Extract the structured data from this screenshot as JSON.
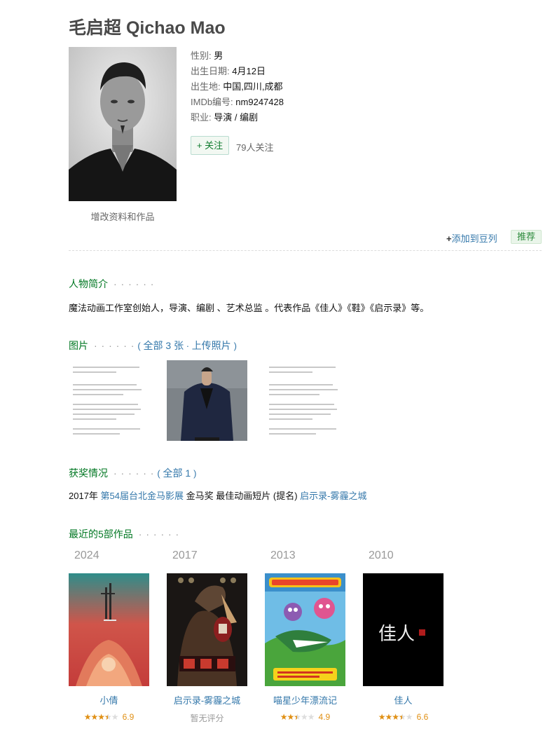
{
  "person": {
    "name": "毛启超 Qichao Mao",
    "gender_label": "性别:",
    "gender": "男",
    "birth_label": "出生日期:",
    "birth": "4月12日",
    "place_label": "出生地:",
    "place": "中国,四川,成都",
    "imdb_label": "IMDb编号:",
    "imdb": "nm9247428",
    "job_label": "职业:",
    "job": "导演 / 编剧"
  },
  "edit_link": "增改资料和作品",
  "follow": {
    "button": "+ 关注",
    "count": "79人关注"
  },
  "actions": {
    "add_doulist": "添加到豆列",
    "recommend": "推荐"
  },
  "intro": {
    "title": "人物简介",
    "dots": "· · · · · ·",
    "text": "魔法动画工作室创始人，导演、编剧 、艺术总监 。代表作品《佳人》《鞋》《启示录》等。"
  },
  "photos": {
    "title": "图片",
    "dots": "· · · · · ·",
    "open": "(",
    "all": "全部 3 张",
    "sep": " · ",
    "upload": "上传照片",
    "close": ")"
  },
  "awards": {
    "title": "获奖情况",
    "dots": "· · · · · ·",
    "open": "(",
    "all": "全部 1",
    "close": ")",
    "year": "2017年",
    "festival": "第54届台北金马影展",
    "award": "金马奖 最佳动画短片 (提名)",
    "work": "启示录-雾霾之城"
  },
  "recent": {
    "title": "最近的5部作品",
    "dots": "· · · · · ·",
    "works": [
      {
        "year": "2024",
        "name": "小倩",
        "rating": "6.9",
        "stars": 3.5
      },
      {
        "year": "2017",
        "name": "启示录-雾霾之城",
        "rating": "暂无评分",
        "stars": 0
      },
      {
        "year": "2013",
        "name": "喵星少年漂流记",
        "rating": "4.9",
        "stars": 2.5
      },
      {
        "year": "2010",
        "name": "佳人",
        "rating": "6.6",
        "stars": 3.5
      }
    ]
  },
  "colors": {
    "green": "#007722",
    "link": "#3377aa",
    "star": "#e09015"
  }
}
